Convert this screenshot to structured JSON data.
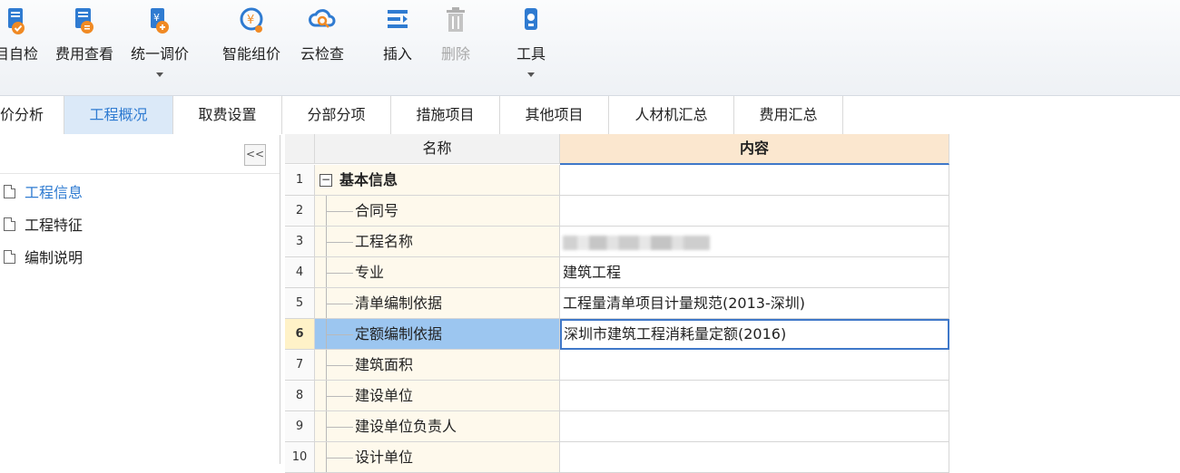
{
  "toolbar": {
    "buttons": [
      {
        "label": "目自检",
        "icon": "self-check-icon"
      },
      {
        "label": "费用查看",
        "icon": "fee-view-icon"
      },
      {
        "label": "统一调价",
        "icon": "unified-price-icon"
      },
      {
        "label": "智能组价",
        "icon": "smart-pricing-icon"
      },
      {
        "label": "云检查",
        "icon": "cloud-check-icon"
      },
      {
        "label": "插入",
        "icon": "insert-icon"
      },
      {
        "label": "删除",
        "icon": "trash-icon"
      },
      {
        "label": "工具",
        "icon": "tools-icon"
      }
    ]
  },
  "tabs": [
    "价分析",
    "工程概况",
    "取费设置",
    "分部分项",
    "措施项目",
    "其他项目",
    "人材机汇总",
    "费用汇总"
  ],
  "sidebar": {
    "collapse_label": "<<",
    "items": [
      "工程信息",
      "工程特征",
      "编制说明"
    ]
  },
  "grid": {
    "headers": {
      "name": "名称",
      "content": "内容"
    },
    "rows": [
      {
        "num": "1",
        "name": "基本信息",
        "content": ""
      },
      {
        "num": "2",
        "name": "合同号",
        "content": ""
      },
      {
        "num": "3",
        "name": "工程名称",
        "content": ""
      },
      {
        "num": "4",
        "name": "专业",
        "content": "建筑工程"
      },
      {
        "num": "5",
        "name": "清单编制依据",
        "content": "工程量清单项目计量规范(2013-深圳)"
      },
      {
        "num": "6",
        "name": "定额编制依据",
        "content": "深圳市建筑工程消耗量定额(2016)"
      },
      {
        "num": "7",
        "name": "建筑面积",
        "content": ""
      },
      {
        "num": "8",
        "name": "建设单位",
        "content": ""
      },
      {
        "num": "9",
        "name": "建设单位负责人",
        "content": ""
      },
      {
        "num": "10",
        "name": "设计单位",
        "content": ""
      }
    ]
  },
  "colors": {
    "accent": "#2f7bd1",
    "active_tab_bg": "#dbe9f8",
    "selected_row_bg": "#9cc6f0",
    "content_header_bg": "#fbe7cf",
    "name_col_bg": "#fef9ec"
  }
}
